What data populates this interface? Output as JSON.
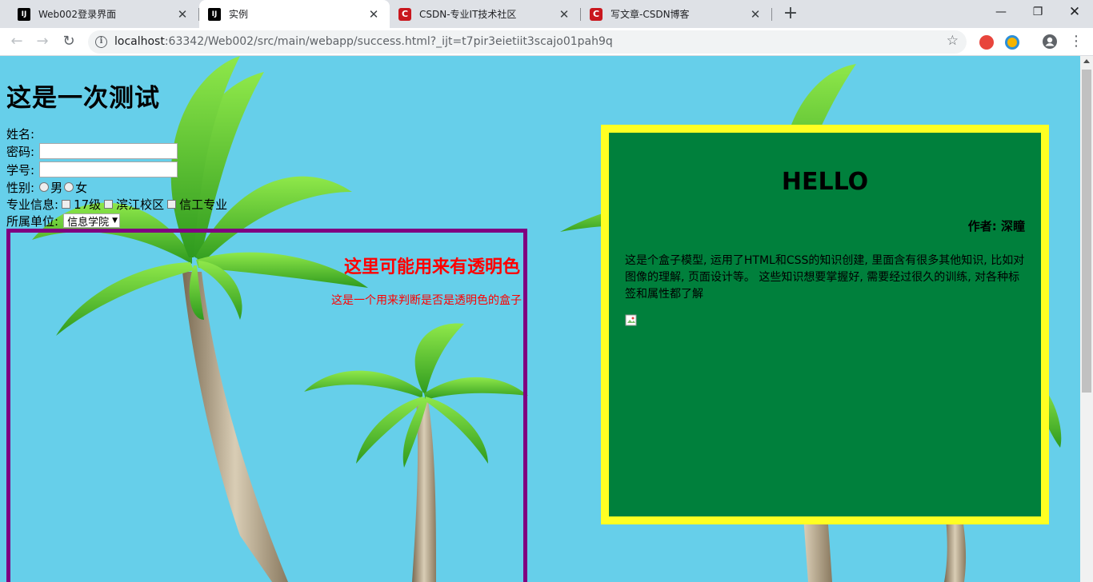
{
  "browser": {
    "tabs": [
      {
        "title": "Web002登录界面",
        "favicon": "intellij-icon"
      },
      {
        "title": "实例",
        "favicon": "intellij-icon",
        "active": true
      },
      {
        "title": "CSDN-专业IT技术社区",
        "favicon": "csdn-icon"
      },
      {
        "title": "写文章-CSDN博客",
        "favicon": "csdn-icon"
      }
    ],
    "url_host": "localhost",
    "url_rest": ":63342/Web002/src/main/webapp/success.html?_ijt=t7pir3eietiit3scajo01pah9q",
    "icons": {
      "back": "back-arrow-icon",
      "forward": "forward-arrow-icon",
      "reload": "reload-icon",
      "info": "info-icon",
      "bookmark": "star-icon",
      "profile": "account-icon",
      "menu": "more-vert-icon"
    }
  },
  "page": {
    "heading": "这是一次测试",
    "form": {
      "name_label": "姓名:",
      "password_label": "密码:",
      "student_id_label": "学号:",
      "gender_label": "性别:",
      "gender_options": [
        "男",
        "女"
      ],
      "major_label": "专业信息:",
      "major_options": [
        "17级",
        "滨江校区",
        "信工专业"
      ],
      "unit_label": "所属单位:",
      "unit_selected": "信息学院"
    },
    "purple_box": {
      "title": "这里可能用来有透明色",
      "text": "这是一个用来判断是否是透明色的盒子"
    },
    "green_box": {
      "heading": "HELLO",
      "author": "作者: 深瞳",
      "paragraph": "这是个盒子模型, 运用了HTML和CSS的知识创建, 里面含有很多其他知识, 比如对图像的理解, 页面设计等。 这些知识想要掌握好, 需要经过很久的训练, 对各种标签和属性都了解"
    },
    "colors": {
      "background": "#66cfea",
      "purple_border": "#800080",
      "red_text": "#ff0000",
      "yellow_border": "#ffff22",
      "green_fill": "#00803c"
    }
  }
}
